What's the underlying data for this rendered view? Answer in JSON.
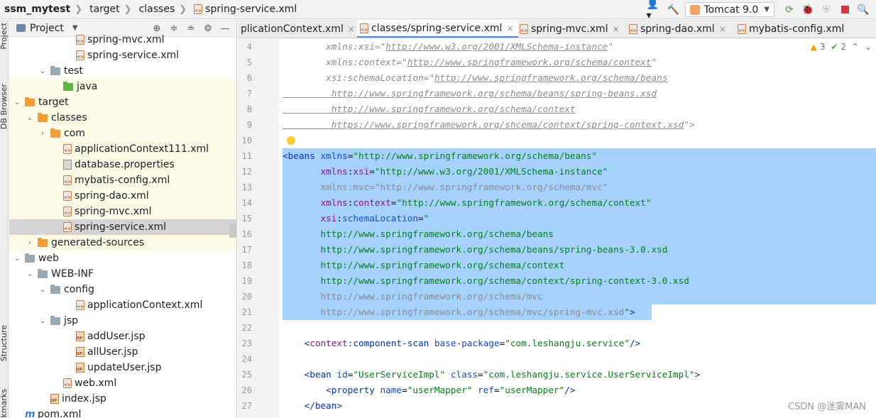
{
  "breadcrumb": {
    "project": "ssm_mytest",
    "items": [
      "target",
      "classes",
      "spring-service.xml"
    ]
  },
  "toolbar": {
    "run_config": "Tomcat 9.0",
    "icons": [
      "user-icon",
      "hammer-icon",
      "run-config-icon",
      "rerun-icon",
      "debug-icon",
      "coverage-icon",
      "stop-icon",
      "search-icon"
    ]
  },
  "left_strip": {
    "labels": [
      "Project",
      "DB Browser",
      "Structure",
      "Bookmarks"
    ]
  },
  "project_panel": {
    "title": "Project",
    "tree": [
      {
        "label": "spring-mvc.xml",
        "icon": "xml",
        "indent": 5,
        "arrow": ""
      },
      {
        "label": "spring-service.xml",
        "icon": "xml",
        "indent": 5,
        "arrow": ""
      },
      {
        "label": "test",
        "icon": "folder-gray",
        "indent": 3,
        "arrow": "down"
      },
      {
        "label": "java",
        "icon": "folder-green",
        "indent": 4,
        "arrow": "",
        "hl": true
      },
      {
        "label": "target",
        "icon": "folder-orange",
        "indent": 1,
        "arrow": "down",
        "hl": true
      },
      {
        "label": "classes",
        "icon": "folder-orange",
        "indent": 2,
        "arrow": "down",
        "hl": true
      },
      {
        "label": "com",
        "icon": "folder-orange",
        "indent": 3,
        "arrow": "right",
        "hl": true
      },
      {
        "label": "applicationContext111.xml",
        "icon": "xml",
        "indent": 4,
        "arrow": "",
        "hl": true
      },
      {
        "label": "database.properties",
        "icon": "prop",
        "indent": 4,
        "arrow": "",
        "hl": true
      },
      {
        "label": "mybatis-config.xml",
        "icon": "xml",
        "indent": 4,
        "arrow": "",
        "hl": true
      },
      {
        "label": "spring-dao.xml",
        "icon": "xml",
        "indent": 4,
        "arrow": "",
        "hl": true
      },
      {
        "label": "spring-mvc.xml",
        "icon": "xml",
        "indent": 4,
        "arrow": "",
        "hl": true
      },
      {
        "label": "spring-service.xml",
        "icon": "xml",
        "indent": 4,
        "arrow": "",
        "sel": true
      },
      {
        "label": "generated-sources",
        "icon": "folder-orange",
        "indent": 2,
        "arrow": "right",
        "hl": true
      },
      {
        "label": "web",
        "icon": "folder-gray",
        "indent": 1,
        "arrow": "down"
      },
      {
        "label": "WEB-INF",
        "icon": "folder-gray",
        "indent": 2,
        "arrow": "down"
      },
      {
        "label": "config",
        "icon": "folder-gray",
        "indent": 3,
        "arrow": "down"
      },
      {
        "label": "applicationContext.xml",
        "icon": "xml",
        "indent": 5,
        "arrow": ""
      },
      {
        "label": "jsp",
        "icon": "folder-gray",
        "indent": 3,
        "arrow": "down"
      },
      {
        "label": "addUser.jsp",
        "icon": "jsp",
        "indent": 5,
        "arrow": ""
      },
      {
        "label": "allUser.jsp",
        "icon": "jsp",
        "indent": 5,
        "arrow": ""
      },
      {
        "label": "updateUser.jsp",
        "icon": "jsp",
        "indent": 5,
        "arrow": ""
      },
      {
        "label": "web.xml",
        "icon": "xml",
        "indent": 4,
        "arrow": ""
      },
      {
        "label": "index.jsp",
        "icon": "jsp",
        "indent": 3,
        "arrow": ""
      },
      {
        "label": "pom.xml",
        "icon": "maven",
        "indent": 1,
        "arrow": ""
      }
    ]
  },
  "tabs": [
    {
      "label": "plicationContext.xml",
      "active": false
    },
    {
      "label": "classes/spring-service.xml",
      "active": true
    },
    {
      "label": "spring-mvc.xml",
      "active": false
    },
    {
      "label": "spring-dao.xml",
      "active": false
    },
    {
      "label": "mybatis-config.xml",
      "active": false
    }
  ],
  "inspections": {
    "warnings": "3",
    "ok": "2"
  },
  "editor": {
    "lines": [
      {
        "n": "4",
        "parts": [
          [
            "ital",
            "        xmlns:xsi=\""
          ],
          [
            "link",
            "http://www.w3.org/2001/XMLSchema-instance"
          ],
          [
            "ital",
            "\""
          ]
        ]
      },
      {
        "n": "5",
        "parts": [
          [
            "ital",
            "        xmlns:context=\""
          ],
          [
            "link",
            "http://www.springframework.org/schema/context"
          ],
          [
            "ital",
            "\""
          ]
        ]
      },
      {
        "n": "6",
        "parts": [
          [
            "ital",
            "        xsi:schemaLocation=\""
          ],
          [
            "link",
            "http://www.springframework.org/schema/beans"
          ]
        ]
      },
      {
        "n": "7",
        "parts": [
          [
            "link",
            "         http://www.springframework.org/schema/beans/spring-beans.xsd"
          ]
        ]
      },
      {
        "n": "8",
        "parts": [
          [
            "link",
            "         http://www.springframework.org/schema/context"
          ]
        ]
      },
      {
        "n": "9",
        "parts": [
          [
            "link",
            "         https://www.springframework.org/shcema/context/spring-context.xsd"
          ],
          [
            "ital",
            "\">"
          ]
        ]
      },
      {
        "n": "10",
        "parts": [
          [
            "gray",
            ""
          ]
        ]
      },
      {
        "n": "11",
        "sel": true,
        "parts": [
          [
            "tag",
            "<beans "
          ],
          [
            "attr",
            "xmlns"
          ],
          [
            "dark",
            "="
          ],
          [
            "str",
            "\"http://www.springframework.org/schema/beans\""
          ]
        ]
      },
      {
        "n": "12",
        "sel": true,
        "parts": [
          [
            "dark",
            "       "
          ],
          [
            "ns",
            "xmlns"
          ],
          [
            "dark",
            ":"
          ],
          [
            "ns",
            "xsi"
          ],
          [
            "dark",
            "="
          ],
          [
            "str",
            "\"http://www.w3.org/2001/XMLSchema-instance\""
          ]
        ]
      },
      {
        "n": "13",
        "sel": true,
        "parts": [
          [
            "gray",
            "       xmlns:mvc=\"http://www.springframework.org/schema/mvc\""
          ]
        ]
      },
      {
        "n": "14",
        "sel": true,
        "parts": [
          [
            "dark",
            "       "
          ],
          [
            "ns",
            "xmlns"
          ],
          [
            "dark",
            ":"
          ],
          [
            "ns",
            "context"
          ],
          [
            "dark",
            "="
          ],
          [
            "str",
            "\"http://www.springframework.org/schema/context\""
          ]
        ]
      },
      {
        "n": "15",
        "sel": true,
        "parts": [
          [
            "dark",
            "       "
          ],
          [
            "ns",
            "xsi"
          ],
          [
            "dark",
            ":"
          ],
          [
            "attr",
            "schemaLocation"
          ],
          [
            "dark",
            "="
          ],
          [
            "str",
            "\""
          ]
        ]
      },
      {
        "n": "16",
        "sel": true,
        "parts": [
          [
            "str",
            "       http://www.springframework.org/schema/beans"
          ]
        ]
      },
      {
        "n": "17",
        "sel": true,
        "parts": [
          [
            "str",
            "       http://www.springframework.org/schema/beans/spring-beans-3.0.xsd"
          ]
        ]
      },
      {
        "n": "18",
        "sel": true,
        "parts": [
          [
            "str",
            "       http://www.springframework.org/schema/context"
          ]
        ]
      },
      {
        "n": "19",
        "sel": true,
        "parts": [
          [
            "str",
            "       http://www.springframework.org/schema/context/spring-context-3.0.xsd"
          ]
        ]
      },
      {
        "n": "20",
        "sel": true,
        "parts": [
          [
            "gray",
            "       http://www.springframework.org/schema/mvc"
          ]
        ]
      },
      {
        "n": "21",
        "sel": true,
        "parts": [
          [
            "gray",
            "       http://www.springframework.org/schema/mvc/spring-mvc.xsd"
          ],
          [
            "str",
            "\""
          ],
          [
            "tag",
            ">"
          ]
        ]
      },
      {
        "n": "22",
        "parts": [
          [
            "dark",
            ""
          ]
        ]
      },
      {
        "n": "23",
        "parts": [
          [
            "dark",
            "    "
          ],
          [
            "tag",
            "<"
          ],
          [
            "ns",
            "context"
          ],
          [
            "tag",
            ":component-scan "
          ],
          [
            "attr",
            "base-package"
          ],
          [
            "dark",
            "="
          ],
          [
            "str",
            "\"com.leshangju.service\""
          ],
          [
            "tag",
            "/>"
          ]
        ]
      },
      {
        "n": "24",
        "parts": [
          [
            "dark",
            ""
          ]
        ]
      },
      {
        "n": "25",
        "parts": [
          [
            "dark",
            "    "
          ],
          [
            "tag",
            "<bean "
          ],
          [
            "attr",
            "id"
          ],
          [
            "dark",
            "="
          ],
          [
            "str",
            "\"UserServiceImpl\""
          ],
          [
            "dark",
            " "
          ],
          [
            "attr",
            "class"
          ],
          [
            "dark",
            "="
          ],
          [
            "str",
            "\"com.leshangju.service.UserServiceImpl\""
          ],
          [
            "tag",
            ">"
          ]
        ]
      },
      {
        "n": "26",
        "parts": [
          [
            "dark",
            "        "
          ],
          [
            "tag",
            "<property "
          ],
          [
            "attr",
            "name"
          ],
          [
            "dark",
            "="
          ],
          [
            "str",
            "\"userMapper\""
          ],
          [
            "dark",
            " "
          ],
          [
            "attr",
            "ref"
          ],
          [
            "dark",
            "="
          ],
          [
            "str",
            "\"userMapper\""
          ],
          [
            "tag",
            "/>"
          ]
        ]
      },
      {
        "n": "27",
        "parts": [
          [
            "dark",
            "    "
          ],
          [
            "tag",
            "</bean>"
          ]
        ]
      }
    ]
  },
  "watermark": "CSDN @迷雾MAN"
}
